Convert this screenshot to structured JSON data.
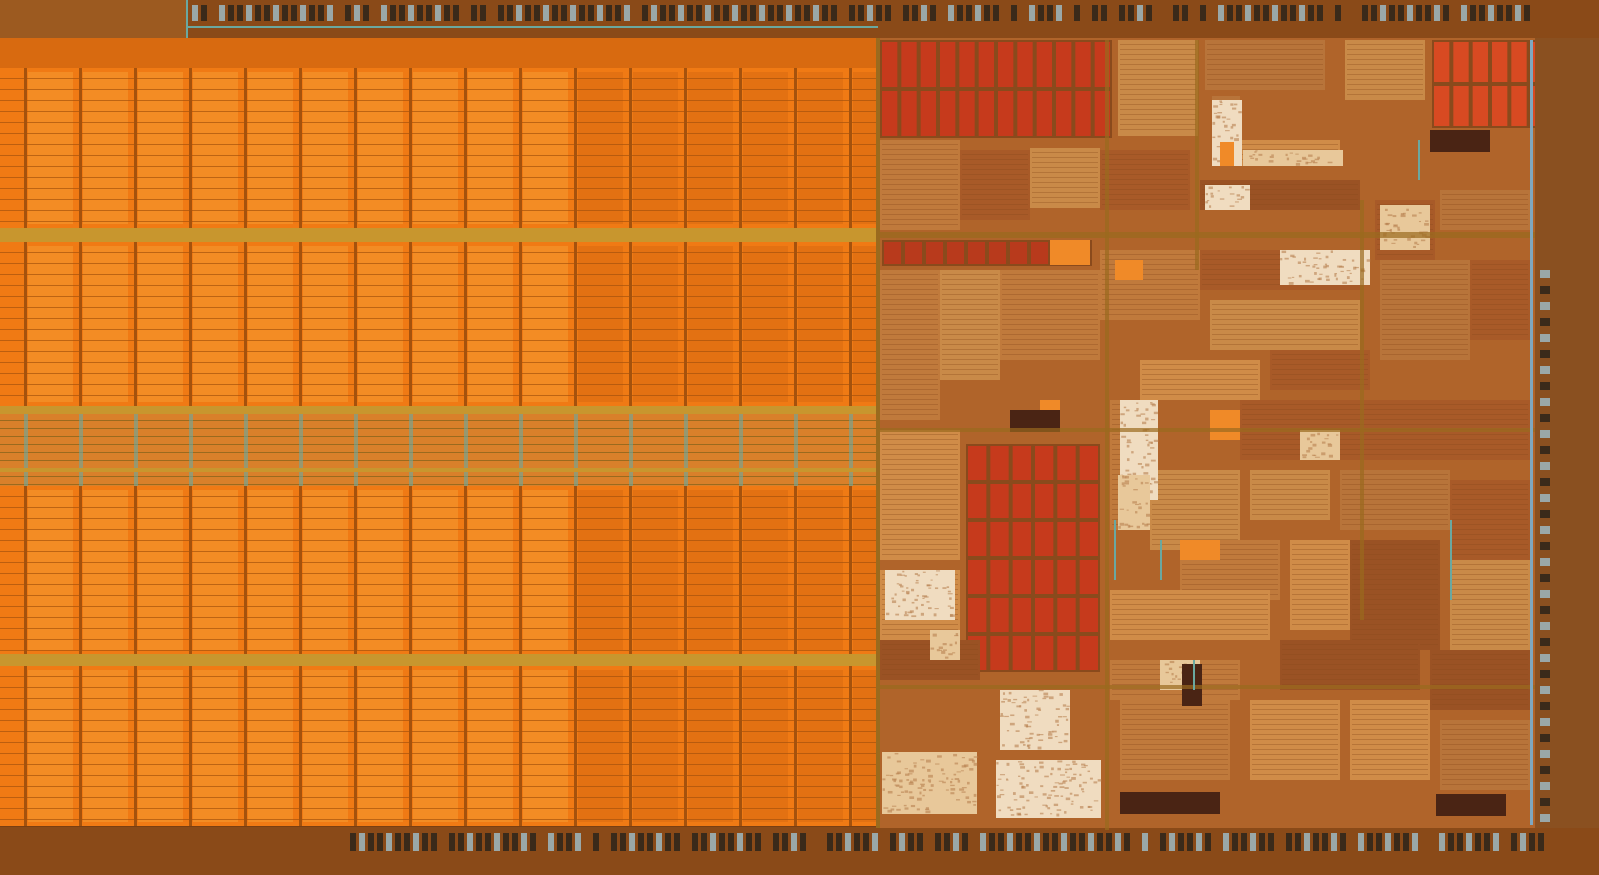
{
  "image": {
    "subject": "die-photo",
    "regions": [
      {
        "id": "pad-ring",
        "icon": "io-pads-icon"
      },
      {
        "id": "cache-array",
        "icon": "sram-array-icon"
      },
      {
        "id": "logic-core",
        "icon": "logic-block-icon"
      }
    ]
  },
  "palette": {
    "background": "#7a3f12",
    "cache_orange": "#f07a14",
    "cache_orange_light": "#f59a32",
    "cache_orange_dark": "#d86a10",
    "cache_grid_line": "#a5520d",
    "bus_gold": "#c8962e",
    "bus_gold_dark": "#9a6a1e",
    "logic_brown": "#b0642a",
    "logic_brown_dark": "#8a4a1c",
    "logic_red": "#c63a1c",
    "logic_red_dark": "#8f2a12",
    "logic_tan": "#c98a48",
    "logic_cream": "#e8c89a",
    "logic_pale": "#f0dcc0",
    "pad_teal": "#6aa8a0",
    "pad_gray": "#9aa8a8",
    "pad_dark": "#3a2a1a",
    "edge_blue": "#7fa8c0"
  }
}
